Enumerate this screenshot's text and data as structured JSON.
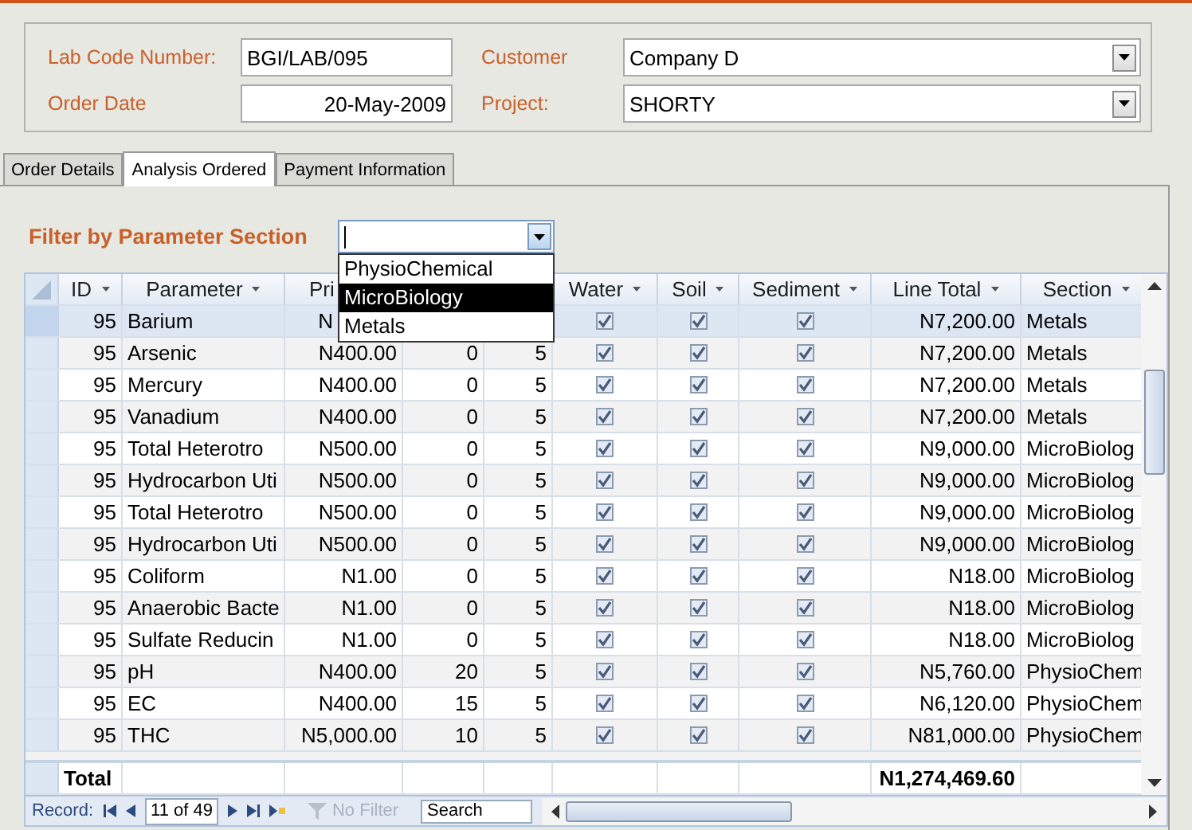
{
  "header": {
    "fields": [
      {
        "label": "Lab Code Number:",
        "value": "BGI/LAB/095",
        "kind": "text"
      },
      {
        "label": "Customer",
        "value": "Company D",
        "kind": "combo"
      },
      {
        "label": "Order Date",
        "value": "20-May-2009",
        "kind": "date"
      },
      {
        "label": "Project:",
        "value": "SHORTY",
        "kind": "combo"
      }
    ]
  },
  "tabs": [
    {
      "label": "Order Details",
      "selected": false
    },
    {
      "label": "Analysis Ordered",
      "selected": true
    },
    {
      "label": "Payment Information",
      "selected": false
    }
  ],
  "filter": {
    "label": "Filter by Parameter Section",
    "options": [
      {
        "label": "PhysioChemical",
        "selected": false
      },
      {
        "label": "MicroBiology",
        "selected": true
      },
      {
        "label": "Metals",
        "selected": false
      }
    ]
  },
  "table": {
    "columns": [
      {
        "label": "ID"
      },
      {
        "label": "Parameter"
      },
      {
        "label": "Pri"
      },
      {},
      {},
      {
        "label": "Water"
      },
      {
        "label": "Soil"
      },
      {
        "label": "Sediment"
      },
      {
        "label": "Line Total"
      },
      {
        "label": "Section"
      }
    ],
    "rows": [
      {
        "id": "95",
        "parameter": "Barium",
        "price": "N",
        "water": true,
        "soil": true,
        "sediment": true,
        "line_total": "N7,200.00",
        "section": "Metals",
        "selected": true
      },
      {
        "id": "95",
        "parameter": "Arsenic",
        "price": "N400.00",
        "column_4": "0",
        "column_5": "5",
        "water": true,
        "soil": true,
        "sediment": true,
        "line_total": "N7,200.00",
        "section": "Metals",
        "selected": false
      },
      {
        "id": "95",
        "parameter": "Mercury",
        "price": "N400.00",
        "column_4": "0",
        "column_5": "5",
        "water": true,
        "soil": true,
        "sediment": true,
        "line_total": "N7,200.00",
        "section": "Metals",
        "selected": false
      },
      {
        "id": "95",
        "parameter": "Vanadium",
        "price": "N400.00",
        "column_4": "0",
        "column_5": "5",
        "water": true,
        "soil": true,
        "sediment": true,
        "line_total": "N7,200.00",
        "section": "Metals",
        "selected": false
      },
      {
        "id": "95",
        "parameter": "Total Heterotro",
        "price": "N500.00",
        "column_4": "0",
        "column_5": "5",
        "water": true,
        "soil": true,
        "sediment": true,
        "line_total": "N9,000.00",
        "section": "MicroBiolog",
        "selected": false
      },
      {
        "id": "95",
        "parameter": "Hydrocarbon Uti",
        "price": "N500.00",
        "column_4": "0",
        "column_5": "5",
        "water": true,
        "soil": true,
        "sediment": true,
        "line_total": "N9,000.00",
        "section": "MicroBiolog",
        "selected": false
      },
      {
        "id": "95",
        "parameter": "Total Heterotro",
        "price": "N500.00",
        "column_4": "0",
        "column_5": "5",
        "water": true,
        "soil": true,
        "sediment": true,
        "line_total": "N9,000.00",
        "section": "MicroBiolog",
        "selected": false
      },
      {
        "id": "95",
        "parameter": "Hydrocarbon Uti",
        "price": "N500.00",
        "column_4": "0",
        "column_5": "5",
        "water": true,
        "soil": true,
        "sediment": true,
        "line_total": "N9,000.00",
        "section": "MicroBiolog",
        "selected": false
      },
      {
        "id": "95",
        "parameter": "Coliform",
        "price": "N1.00",
        "column_4": "0",
        "column_5": "5",
        "water": true,
        "soil": true,
        "sediment": true,
        "line_total": "N18.00",
        "section": "MicroBiolog",
        "selected": false
      },
      {
        "id": "95",
        "parameter": "Anaerobic Bacte",
        "price": "N1.00",
        "column_4": "0",
        "column_5": "5",
        "water": true,
        "soil": true,
        "sediment": true,
        "line_total": "N18.00",
        "section": "MicroBiolog",
        "selected": false
      },
      {
        "id": "95",
        "parameter": "Sulfate Reducin",
        "price": "N1.00",
        "column_4": "0",
        "column_5": "5",
        "water": true,
        "soil": true,
        "sediment": true,
        "line_total": "N18.00",
        "section": "MicroBiolog",
        "selected": false
      },
      {
        "id": "95",
        "parameter": "pH",
        "price": "N400.00",
        "column_4": "20",
        "column_5": "5",
        "water": true,
        "soil": true,
        "sediment": true,
        "line_total": "N5,760.00",
        "section": "PhysioChem",
        "selected": false
      },
      {
        "id": "95",
        "parameter": "EC",
        "price": "N400.00",
        "column_4": "15",
        "column_5": "5",
        "water": true,
        "soil": true,
        "sediment": true,
        "line_total": "N6,120.00",
        "section": "PhysioChem",
        "selected": false
      },
      {
        "id": "95",
        "parameter": "THC",
        "price": "N5,000.00",
        "column_4": "10",
        "column_5": "5",
        "water": true,
        "soil": true,
        "sediment": true,
        "line_total": "N81,000.00",
        "section": "PhysioChem",
        "selected": false
      }
    ],
    "total": {
      "label": "Total",
      "line_total": "N1,274,469.60"
    }
  },
  "navigation": {
    "label": "Record:",
    "position": "11 of 49",
    "filter": {
      "label": "No Filter",
      "disabled": true
    },
    "search": {
      "placeholder": "Search"
    }
  }
}
